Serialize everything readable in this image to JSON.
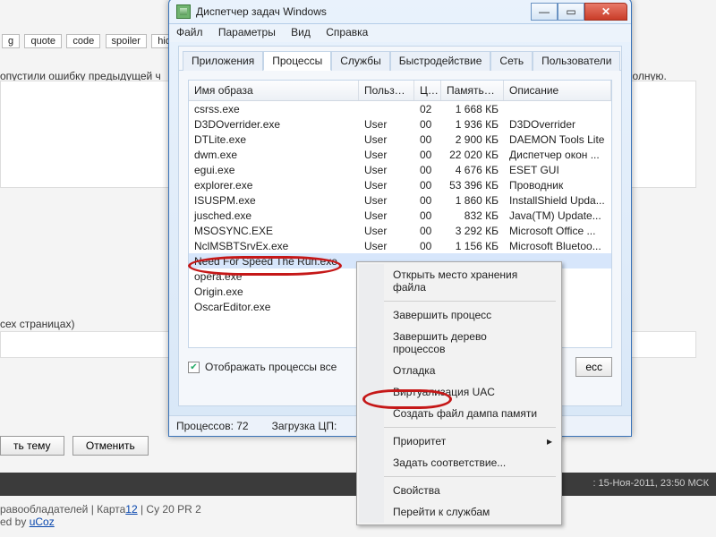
{
  "bg": {
    "toolbar": [
      "quote",
      "code",
      "spoiler",
      "hide"
    ],
    "line1": "опустили ошибку предыдущей ч",
    "line1_suffix": "полную.",
    "line2": "сех страницах)",
    "btn_submit": "ть тему",
    "btn_cancel": "Отменить",
    "status": ": 15-Ноя-2011, 23:50 МСК",
    "footer_left": "равообладателей | Карта",
    "footer_link1": "12",
    "footer_mid": " | Су 20 PR 2",
    "footer2": "ed by ",
    "footer2_link": "uCoz"
  },
  "win": {
    "title": "Диспетчер задач Windows",
    "menu": [
      "Файл",
      "Параметры",
      "Вид",
      "Справка"
    ],
    "tabs": [
      "Приложения",
      "Процессы",
      "Службы",
      "Быстродействие",
      "Сеть",
      "Пользователи"
    ],
    "active_tab": 1,
    "columns": {
      "name": "Имя образа",
      "user": "Пользо...",
      "cpu": "ЦП",
      "mem": "Память (...",
      "desc": "Описание"
    },
    "rows": [
      {
        "name": "csrss.exe",
        "user": "",
        "cpu": "02",
        "mem": "1 668 КБ",
        "desc": ""
      },
      {
        "name": "D3DOverrider.exe",
        "user": "User",
        "cpu": "00",
        "mem": "1 936 КБ",
        "desc": "D3DOverrider"
      },
      {
        "name": "DTLite.exe",
        "user": "User",
        "cpu": "00",
        "mem": "2 900 КБ",
        "desc": "DAEMON Tools Lite"
      },
      {
        "name": "dwm.exe",
        "user": "User",
        "cpu": "00",
        "mem": "22 020 КБ",
        "desc": "Диспетчер окон ..."
      },
      {
        "name": "egui.exe",
        "user": "User",
        "cpu": "00",
        "mem": "4 676 КБ",
        "desc": "ESET GUI"
      },
      {
        "name": "explorer.exe",
        "user": "User",
        "cpu": "00",
        "mem": "53 396 КБ",
        "desc": "Проводник"
      },
      {
        "name": "ISUSPM.exe",
        "user": "User",
        "cpu": "00",
        "mem": "1 860 КБ",
        "desc": "InstallShield Upda..."
      },
      {
        "name": "jusched.exe",
        "user": "User",
        "cpu": "00",
        "mem": "832 КБ",
        "desc": "Java(TM) Update..."
      },
      {
        "name": "MSOSYNC.EXE",
        "user": "User",
        "cpu": "00",
        "mem": "3 292 КБ",
        "desc": "Microsoft Office ..."
      },
      {
        "name": "NclMSBTSrvEx.exe",
        "user": "User",
        "cpu": "00",
        "mem": "1 156 КБ",
        "desc": "Microsoft Bluetoo..."
      },
      {
        "name": "Need For Speed The Run.exe",
        "user": "",
        "cpu": "",
        "mem": "",
        "desc": ""
      },
      {
        "name": "opera.exe",
        "user": "",
        "cpu": "",
        "mem": "",
        "desc": ""
      },
      {
        "name": "Origin.exe",
        "user": "",
        "cpu": "",
        "mem": "",
        "desc": ""
      },
      {
        "name": "OscarEditor.exe",
        "user": "",
        "cpu": "",
        "mem": "",
        "desc": ""
      }
    ],
    "selected_row": 10,
    "show_all_label": "Отображать процессы все",
    "end_process_label": "есс",
    "status": {
      "processes_label": "Процессов:",
      "processes": "72",
      "cpu_label": "Загрузка ЦП:"
    }
  },
  "ctx": {
    "items": [
      {
        "label": "Открыть место хранения файла"
      },
      {
        "label": "Завершить процесс",
        "sep_before": true
      },
      {
        "label": "Завершить дерево процессов"
      },
      {
        "label": "Отладка"
      },
      {
        "label": "Виртуализация UAC"
      },
      {
        "label": "Создать файл дампа памяти"
      },
      {
        "label": "Приоритет",
        "sep_before": true,
        "arrow": true
      },
      {
        "label": "Задать соответствие..."
      },
      {
        "label": "Свойства",
        "sep_before": true
      },
      {
        "label": "Перейти к службам"
      }
    ]
  }
}
